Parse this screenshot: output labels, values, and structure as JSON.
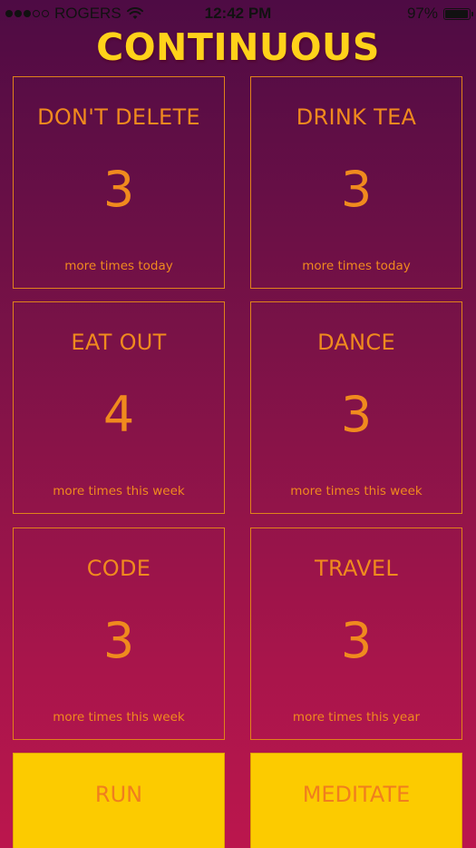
{
  "status_bar": {
    "carrier": "ROGERS",
    "time": "12:42 PM",
    "battery_text": "97%",
    "battery_level": 0.97,
    "signal_filled": 3,
    "signal_total": 5
  },
  "app": {
    "title": "CONTINUOUS"
  },
  "cards": [
    {
      "title": "DON'T DELETE",
      "count": "3",
      "subtitle": "more times today"
    },
    {
      "title": "DRINK TEA",
      "count": "3",
      "subtitle": "more times today"
    },
    {
      "title": "EAT OUT",
      "count": "4",
      "subtitle": "more times this week"
    },
    {
      "title": "DANCE",
      "count": "3",
      "subtitle": "more times this week"
    },
    {
      "title": "CODE",
      "count": "3",
      "subtitle": "more times this week"
    },
    {
      "title": "TRAVEL",
      "count": "3",
      "subtitle": "more times this year"
    }
  ],
  "actions": [
    {
      "label": "RUN"
    },
    {
      "label": "MEDITATE"
    }
  ],
  "colors": {
    "title": "#ffd21a",
    "card_text": "#f08a1e",
    "card_border": "#e0821a",
    "action_bg": "#fccb00",
    "action_text": "#f07e1e",
    "bg_top": "#4e0b44",
    "bg_bottom": "#bb164d"
  },
  "icons": {
    "signal": "signal-dots-icon",
    "wifi": "wifi-icon",
    "battery": "battery-icon"
  }
}
